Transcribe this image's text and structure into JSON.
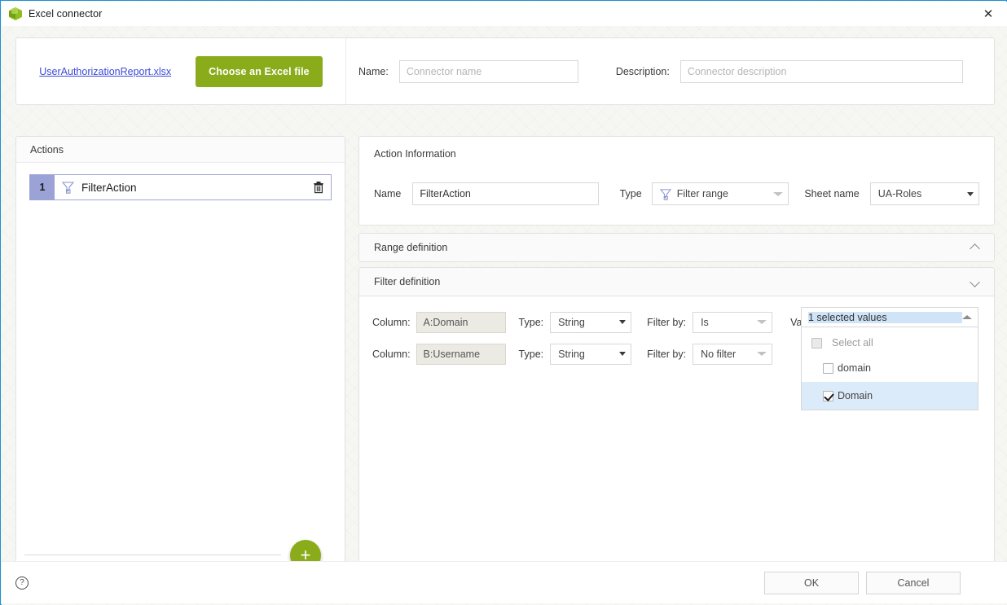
{
  "window": {
    "title": "Excel connector",
    "app_icon": "hexagon-green-icon",
    "close_label": "✕",
    "accent_border": "#1e90d2"
  },
  "topbar": {
    "file_link": "UserAuthorizationReport.xlsx",
    "choose_file_label": "Choose an Excel file",
    "choose_file_color": "#8aac1b",
    "name_label": "Name:",
    "name_value": "",
    "name_placeholder": "Connector name",
    "description_label": "Description:",
    "description_value": "",
    "description_placeholder": "Connector description"
  },
  "actions_panel": {
    "header": "Actions",
    "items": [
      {
        "index": "1",
        "name": "FilterAction",
        "icon": "filter-icon",
        "delete_icon": "trash-icon"
      }
    ],
    "add_button_label": "+",
    "badge_color": "#9ba3d6"
  },
  "action_information": {
    "caption": "Action Information",
    "name_label": "Name",
    "name_value": "FilterAction",
    "type_label": "Type",
    "type_value": "Filter range",
    "type_icon": "filter-icon",
    "sheet_label": "Sheet name",
    "sheet_value": "UA-Roles"
  },
  "sections": {
    "range_definition": {
      "title": "Range definition",
      "chevron": "chevron-up-icon",
      "expanded": true
    },
    "filter_definition": {
      "title": "Filter definition",
      "chevron": "chevron-down-icon",
      "expanded": true
    }
  },
  "filter_rows": [
    {
      "column_label": "Column:",
      "column_value": "A:Domain",
      "type_label": "Type:",
      "type_value": "String",
      "filter_by_label": "Filter by:",
      "filter_by_value": "Is",
      "value_label": "Value:"
    },
    {
      "column_label": "Column:",
      "column_value": "B:Username",
      "type_label": "Type:",
      "type_value": "String",
      "filter_by_label": "Filter by:",
      "filter_by_value": "No filter",
      "value_label": ""
    }
  ],
  "value_multiselect": {
    "summary": "1 selected values",
    "caret": "caret-up-icon",
    "select_all_label": "Select all",
    "select_all_checked": false,
    "options": [
      {
        "label": "domain",
        "checked": false,
        "highlighted": false
      },
      {
        "label": "Domain",
        "checked": true,
        "highlighted": true
      }
    ],
    "highlight_color": "#dcebf9"
  },
  "footer": {
    "help_icon": "question-mark-icon",
    "help_glyph": "?",
    "ok_label": "OK",
    "cancel_label": "Cancel"
  }
}
